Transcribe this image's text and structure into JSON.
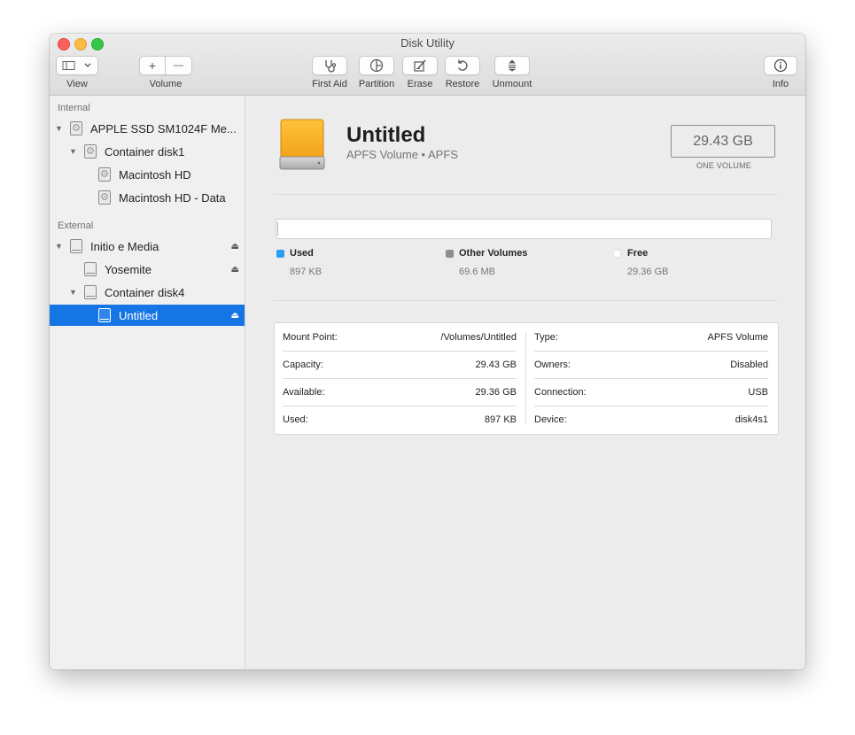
{
  "window": {
    "title": "Disk Utility"
  },
  "toolbar": {
    "view_label": "View",
    "volume_label": "Volume",
    "first_aid_label": "First Aid",
    "partition_label": "Partition",
    "erase_label": "Erase",
    "restore_label": "Restore",
    "unmount_label": "Unmount",
    "info_label": "Info",
    "add_glyph": "+",
    "remove_glyph": "—"
  },
  "sidebar": {
    "internal_header": "Internal",
    "external_header": "External",
    "items": [
      {
        "label": "APPLE SSD SM1024F Me..."
      },
      {
        "label": "Container disk1"
      },
      {
        "label": "Macintosh HD"
      },
      {
        "label": "Macintosh HD - Data"
      },
      {
        "label": "Initio e Media"
      },
      {
        "label": "Yosemite"
      },
      {
        "label": "Container disk4"
      },
      {
        "label": "Untitled"
      }
    ]
  },
  "volume": {
    "name": "Untitled",
    "subtitle": "APFS Volume • APFS",
    "size": "29.43 GB",
    "size_caption": "ONE VOLUME"
  },
  "usage": {
    "used_label": "Used",
    "used_value": "897 KB",
    "used_color": "#2a9df4",
    "other_label": "Other Volumes",
    "other_value": "69.6 MB",
    "other_color": "#8e8e8e",
    "free_label": "Free",
    "free_value": "29.36 GB",
    "free_color": "#ffffff"
  },
  "details": {
    "left": [
      {
        "label": "Mount Point:",
        "value": "/Volumes/Untitled"
      },
      {
        "label": "Capacity:",
        "value": "29.43 GB"
      },
      {
        "label": "Available:",
        "value": "29.36 GB"
      },
      {
        "label": "Used:",
        "value": "897 KB"
      }
    ],
    "right": [
      {
        "label": "Type:",
        "value": "APFS Volume"
      },
      {
        "label": "Owners:",
        "value": "Disabled"
      },
      {
        "label": "Connection:",
        "value": "USB"
      },
      {
        "label": "Device:",
        "value": "disk4s1"
      }
    ]
  }
}
